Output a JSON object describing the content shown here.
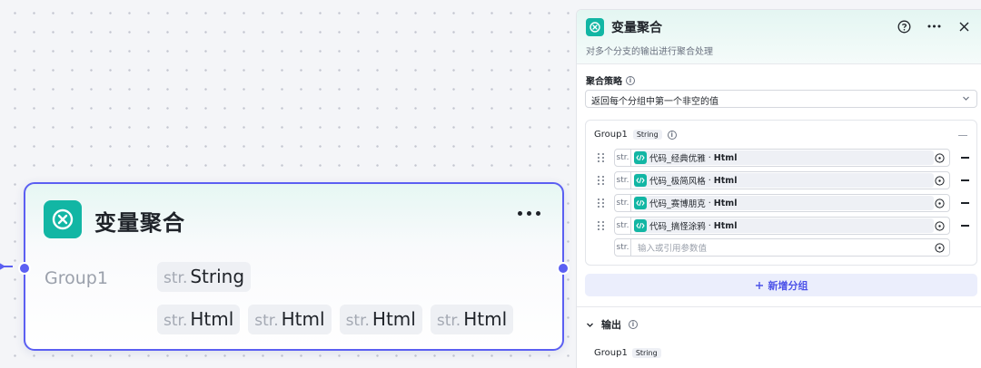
{
  "node": {
    "title": "变量聚合",
    "group_label": "Group1",
    "type_prefix": "str.",
    "type": "String",
    "tags": [
      {
        "prefix": "str.",
        "label": "Html"
      },
      {
        "prefix": "str.",
        "label": "Html"
      },
      {
        "prefix": "str.",
        "label": "Html"
      },
      {
        "prefix": "str.",
        "label": "Html"
      }
    ]
  },
  "panel": {
    "title": "变量聚合",
    "description": "对多个分支的输出进行聚合处理",
    "strategy_label": "聚合策略",
    "strategy_value": "返回每个分组中第一个非空的值",
    "group": {
      "name": "Group1",
      "type": "String",
      "variables": [
        {
          "prefix": "str.",
          "source": "代码_经典优雅",
          "sep": " · ",
          "field": "Html"
        },
        {
          "prefix": "str.",
          "source": "代码_极简风格",
          "sep": " · ",
          "field": "Html"
        },
        {
          "prefix": "str.",
          "source": "代码_赛博朋克",
          "sep": " · ",
          "field": "Html"
        },
        {
          "prefix": "str.",
          "source": "代码_搞怪涂鸦",
          "sep": " · ",
          "field": "Html"
        }
      ],
      "empty_prefix": "str.",
      "empty_placeholder": "输入或引用参数值"
    },
    "add_group_label": "新增分组",
    "output_label": "输出",
    "output_group": {
      "name": "Group1",
      "type": "String"
    }
  },
  "colors": {
    "accent": "#5b5ff2",
    "brand_teal": "#12b6a4",
    "add_group_text": "#4d53e8"
  },
  "icons": [
    "variable-merge-icon",
    "help-icon",
    "more-icon",
    "close-icon",
    "info-icon",
    "chevron-down-icon",
    "drag-handle-icon",
    "code-icon",
    "variable-picker-icon",
    "remove-icon",
    "plus-icon"
  ]
}
